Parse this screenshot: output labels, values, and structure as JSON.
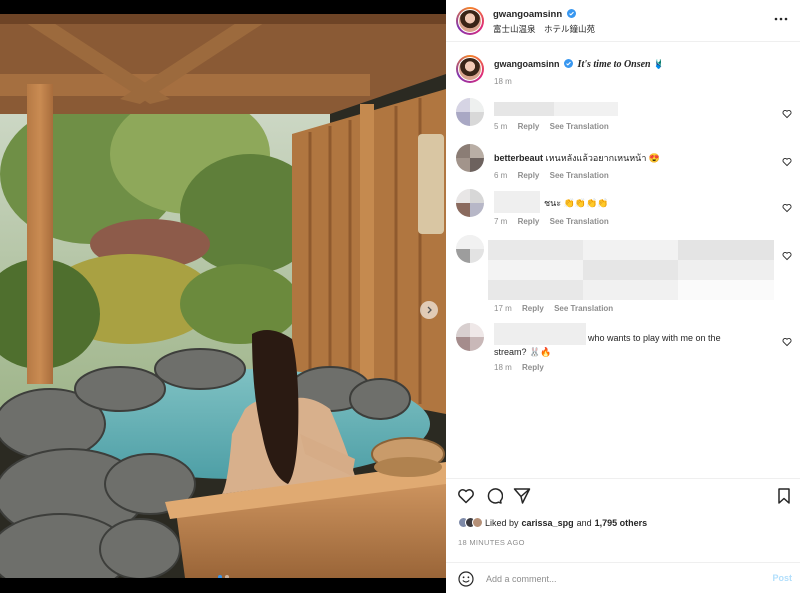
{
  "post": {
    "username": "gwangoamsinn",
    "location": "富士山温泉　ホテル鐘山苑",
    "caption": "It's time to Onsen",
    "caption_emoji": "🩱",
    "caption_age": "18 m",
    "carousel": {
      "slides": 2,
      "active_index": 0
    }
  },
  "comment_actions": {
    "reply": "Reply",
    "translate": "See Translation"
  },
  "comments": [
    {
      "user": "",
      "text": "",
      "age": "5 m",
      "username_blurred": true
    },
    {
      "user": "betterbeaut",
      "text": "เหนหลังแล้วอยากเหนหน้า",
      "emoji": "😍",
      "age": "6 m"
    },
    {
      "user": "",
      "text": "ชนะ",
      "emoji": "👏👏👏👏",
      "age": "7 m",
      "username_blurred": true
    },
    {
      "user": "",
      "text": "",
      "age": "17 m",
      "username_blurred": true
    },
    {
      "user": "",
      "text": "who wants to play with me on the stream?",
      "emoji": "🐰🔥",
      "age": "18 m",
      "username_blurred": true
    }
  ],
  "likes": {
    "prefix": "Liked by",
    "user": "carissa_spg",
    "joiner": "and",
    "count": "1,795 others"
  },
  "timestamp": "18 MINUTES AGO",
  "add_comment": {
    "placeholder": "Add a comment...",
    "post_label": "Post"
  },
  "icons": {
    "more": "more-horizontal-icon",
    "verified": "verified-badge-icon",
    "like": "heart-outline-icon",
    "comment": "comment-bubble-icon",
    "share": "paper-plane-icon",
    "save": "bookmark-icon",
    "emoji": "smiley-icon",
    "next": "chevron-right-icon"
  },
  "colors": {
    "verified": "#3897f0",
    "link_disabled": "#b2dffc",
    "secondary_text": "#8e8e8e"
  }
}
